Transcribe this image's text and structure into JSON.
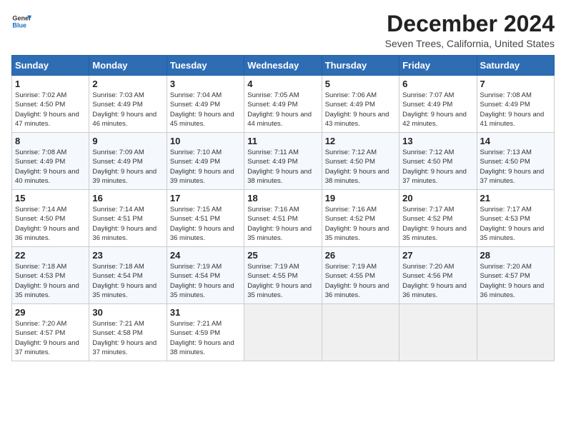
{
  "header": {
    "logo_line1": "General",
    "logo_line2": "Blue",
    "title": "December 2024",
    "subtitle": "Seven Trees, California, United States"
  },
  "weekdays": [
    "Sunday",
    "Monday",
    "Tuesday",
    "Wednesday",
    "Thursday",
    "Friday",
    "Saturday"
  ],
  "weeks": [
    [
      {
        "day": "1",
        "sunrise": "7:02 AM",
        "sunset": "4:50 PM",
        "daylight": "9 hours and 47 minutes."
      },
      {
        "day": "2",
        "sunrise": "7:03 AM",
        "sunset": "4:49 PM",
        "daylight": "9 hours and 46 minutes."
      },
      {
        "day": "3",
        "sunrise": "7:04 AM",
        "sunset": "4:49 PM",
        "daylight": "9 hours and 45 minutes."
      },
      {
        "day": "4",
        "sunrise": "7:05 AM",
        "sunset": "4:49 PM",
        "daylight": "9 hours and 44 minutes."
      },
      {
        "day": "5",
        "sunrise": "7:06 AM",
        "sunset": "4:49 PM",
        "daylight": "9 hours and 43 minutes."
      },
      {
        "day": "6",
        "sunrise": "7:07 AM",
        "sunset": "4:49 PM",
        "daylight": "9 hours and 42 minutes."
      },
      {
        "day": "7",
        "sunrise": "7:08 AM",
        "sunset": "4:49 PM",
        "daylight": "9 hours and 41 minutes."
      }
    ],
    [
      {
        "day": "8",
        "sunrise": "7:08 AM",
        "sunset": "4:49 PM",
        "daylight": "9 hours and 40 minutes."
      },
      {
        "day": "9",
        "sunrise": "7:09 AM",
        "sunset": "4:49 PM",
        "daylight": "9 hours and 39 minutes."
      },
      {
        "day": "10",
        "sunrise": "7:10 AM",
        "sunset": "4:49 PM",
        "daylight": "9 hours and 39 minutes."
      },
      {
        "day": "11",
        "sunrise": "7:11 AM",
        "sunset": "4:49 PM",
        "daylight": "9 hours and 38 minutes."
      },
      {
        "day": "12",
        "sunrise": "7:12 AM",
        "sunset": "4:50 PM",
        "daylight": "9 hours and 38 minutes."
      },
      {
        "day": "13",
        "sunrise": "7:12 AM",
        "sunset": "4:50 PM",
        "daylight": "9 hours and 37 minutes."
      },
      {
        "day": "14",
        "sunrise": "7:13 AM",
        "sunset": "4:50 PM",
        "daylight": "9 hours and 37 minutes."
      }
    ],
    [
      {
        "day": "15",
        "sunrise": "7:14 AM",
        "sunset": "4:50 PM",
        "daylight": "9 hours and 36 minutes."
      },
      {
        "day": "16",
        "sunrise": "7:14 AM",
        "sunset": "4:51 PM",
        "daylight": "9 hours and 36 minutes."
      },
      {
        "day": "17",
        "sunrise": "7:15 AM",
        "sunset": "4:51 PM",
        "daylight": "9 hours and 36 minutes."
      },
      {
        "day": "18",
        "sunrise": "7:16 AM",
        "sunset": "4:51 PM",
        "daylight": "9 hours and 35 minutes."
      },
      {
        "day": "19",
        "sunrise": "7:16 AM",
        "sunset": "4:52 PM",
        "daylight": "9 hours and 35 minutes."
      },
      {
        "day": "20",
        "sunrise": "7:17 AM",
        "sunset": "4:52 PM",
        "daylight": "9 hours and 35 minutes."
      },
      {
        "day": "21",
        "sunrise": "7:17 AM",
        "sunset": "4:53 PM",
        "daylight": "9 hours and 35 minutes."
      }
    ],
    [
      {
        "day": "22",
        "sunrise": "7:18 AM",
        "sunset": "4:53 PM",
        "daylight": "9 hours and 35 minutes."
      },
      {
        "day": "23",
        "sunrise": "7:18 AM",
        "sunset": "4:54 PM",
        "daylight": "9 hours and 35 minutes."
      },
      {
        "day": "24",
        "sunrise": "7:19 AM",
        "sunset": "4:54 PM",
        "daylight": "9 hours and 35 minutes."
      },
      {
        "day": "25",
        "sunrise": "7:19 AM",
        "sunset": "4:55 PM",
        "daylight": "9 hours and 35 minutes."
      },
      {
        "day": "26",
        "sunrise": "7:19 AM",
        "sunset": "4:55 PM",
        "daylight": "9 hours and 36 minutes."
      },
      {
        "day": "27",
        "sunrise": "7:20 AM",
        "sunset": "4:56 PM",
        "daylight": "9 hours and 36 minutes."
      },
      {
        "day": "28",
        "sunrise": "7:20 AM",
        "sunset": "4:57 PM",
        "daylight": "9 hours and 36 minutes."
      }
    ],
    [
      {
        "day": "29",
        "sunrise": "7:20 AM",
        "sunset": "4:57 PM",
        "daylight": "9 hours and 37 minutes."
      },
      {
        "day": "30",
        "sunrise": "7:21 AM",
        "sunset": "4:58 PM",
        "daylight": "9 hours and 37 minutes."
      },
      {
        "day": "31",
        "sunrise": "7:21 AM",
        "sunset": "4:59 PM",
        "daylight": "9 hours and 38 minutes."
      },
      null,
      null,
      null,
      null
    ]
  ]
}
